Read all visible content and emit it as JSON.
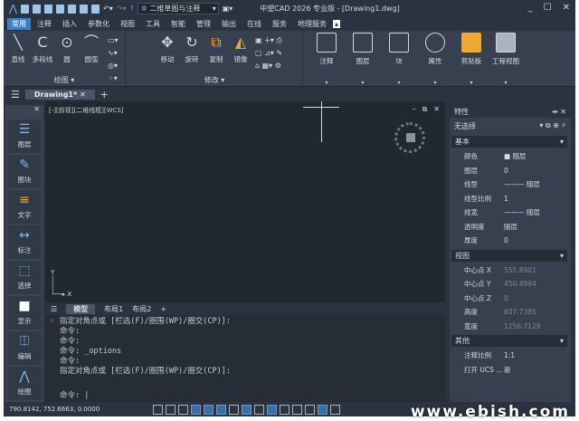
{
  "titlebar": {
    "workspace": "二维草图与注释",
    "title": "中望CAD 2026 专业版 - [Drawing1.dwg]"
  },
  "menu": [
    "常用",
    "注释",
    "插入",
    "参数化",
    "视图",
    "工具",
    "智能",
    "管理",
    "输出",
    "在线",
    "服务",
    "地理服务"
  ],
  "ribbon": {
    "draw": {
      "title": "绘图",
      "tools": [
        "直线",
        "多段线",
        "圆",
        "圆弧"
      ]
    },
    "modify": {
      "title": "修改",
      "tools": [
        "移动",
        "旋转",
        "复制",
        "镜像"
      ]
    },
    "panels": [
      "注释",
      "图层",
      "块",
      "属性",
      "剪贴板",
      "工程视图"
    ]
  },
  "doc_tab": "Drawing1*",
  "left_toolbar": [
    "图层",
    "图块",
    "文字",
    "标注",
    "选择",
    "显示",
    "编辑",
    "绘图"
  ],
  "viewport_label": "[-][前视][二维线框][WCS]",
  "layout_tabs": [
    "模型",
    "布局1",
    "布局2"
  ],
  "command": {
    "history": [
      "指定对角点或 [栏选(F)/圈围(WP)/圈交(CP)]:",
      "命令:",
      "命令:",
      "命令: _options",
      "命令:",
      "指定对角点或 [栏选(F)/圈围(WP)/圈交(CP)]:"
    ],
    "prompt": "命令:"
  },
  "properties": {
    "title": "特性",
    "selection": "无选择",
    "sections": [
      {
        "name": "基本",
        "rows": [
          [
            "颜色",
            "■ 随层"
          ],
          [
            "图层",
            "0"
          ],
          [
            "线型",
            "——— 随层"
          ],
          [
            "线型比例",
            "1"
          ],
          [
            "线宽",
            "——— 随层"
          ],
          [
            "透明度",
            "随层"
          ],
          [
            "厚度",
            "0"
          ]
        ]
      },
      {
        "name": "视图",
        "rows": [
          [
            "中心点 X",
            "555.8901"
          ],
          [
            "中心点 Y",
            "450.4994"
          ],
          [
            "中心点 Z",
            "0"
          ],
          [
            "高度",
            "607.7385"
          ],
          [
            "宽度",
            "1256.7129"
          ]
        ]
      },
      {
        "name": "其他",
        "rows": [
          [
            "注释比例",
            "1:1"
          ],
          [
            "打开 UCS ...",
            "是"
          ]
        ]
      }
    ]
  },
  "status": {
    "coords": "790.8142, 752.6663, 0.0000"
  },
  "watermark": "www.ebish.com"
}
